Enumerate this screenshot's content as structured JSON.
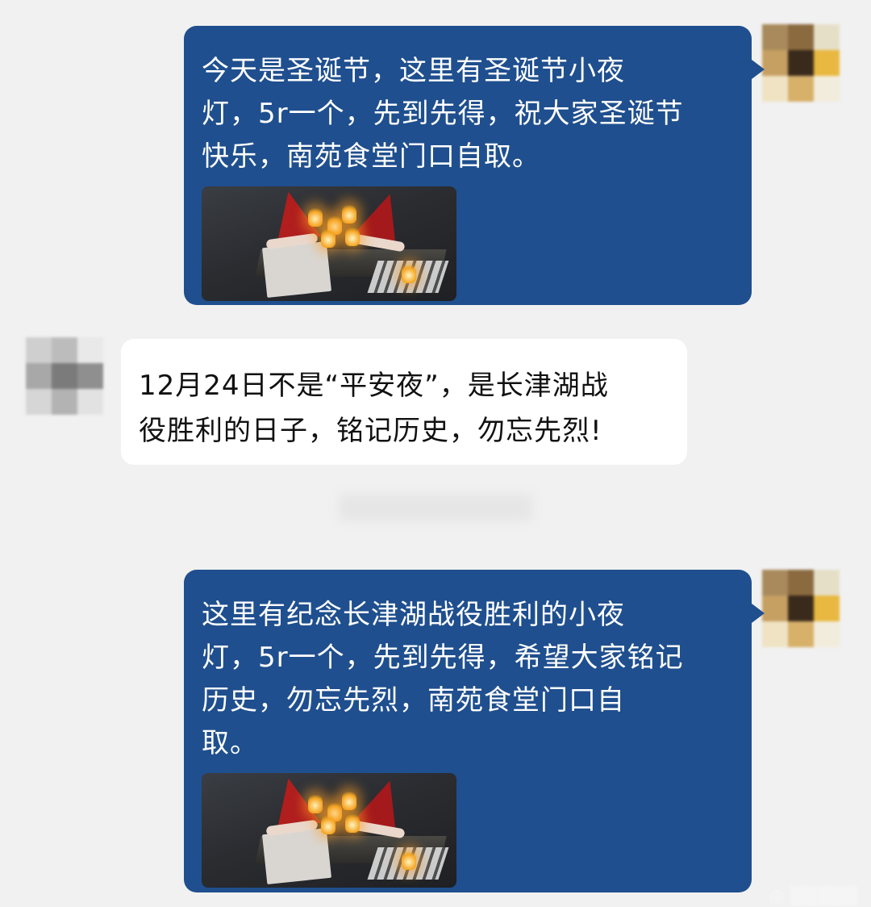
{
  "messages": [
    {
      "side": "right",
      "text": "今天是圣诞节，这里有圣诞节小夜\n灯，5r一个，先到先得，祝大家圣诞节\n快乐，南苑食堂门口自取。",
      "has_photo": true
    },
    {
      "side": "left",
      "text": "12月24日不是“平安夜”，是长津湖战\n役胜利的日子，铭记历史，勿忘先烈!"
    },
    {
      "side": "right",
      "text": "这里有纪念长津湖战役胜利的小夜\n灯，5r一个，先到先得，希望大家铭记\n历史，勿忘先烈，南苑食堂门口自\n取。",
      "has_photo": true
    }
  ],
  "colors": {
    "sent_bubble": "#1f4f8e",
    "received_bubble": "#ffffff",
    "background": "#f1f1f1"
  }
}
